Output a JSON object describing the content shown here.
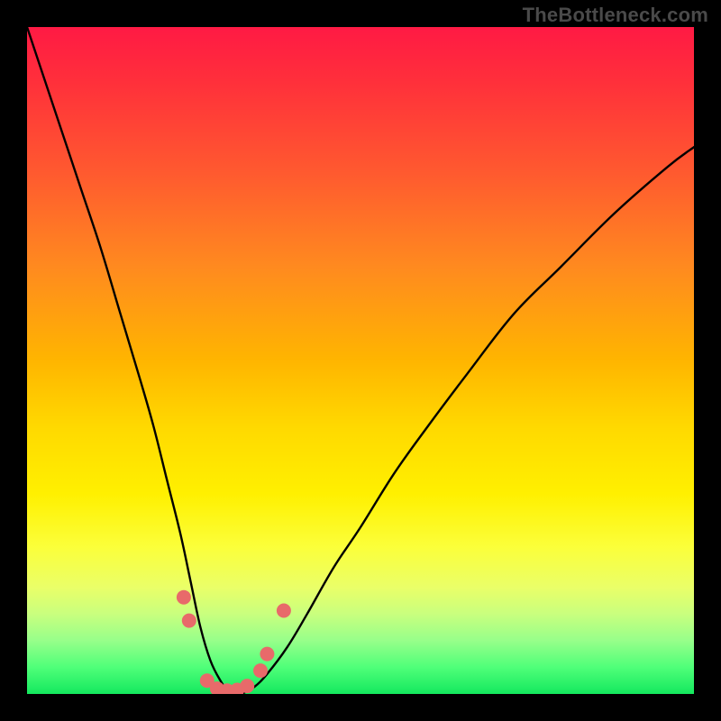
{
  "watermark": {
    "text": "TheBottleneck.com"
  },
  "chart_data": {
    "type": "line",
    "title": "",
    "xlabel": "",
    "ylabel": "",
    "xlim": [
      0,
      100
    ],
    "ylim": [
      0,
      100
    ],
    "grid": false,
    "legend": false,
    "series": [
      {
        "name": "bottleneck-curve",
        "x": [
          0,
          2,
          5,
          8,
          11,
          14,
          17,
          19,
          21,
          23,
          24.5,
          26,
          27.5,
          29,
          30.5,
          32,
          34,
          36,
          39,
          42,
          46,
          50,
          55,
          60,
          66,
          73,
          80,
          88,
          96,
          100
        ],
        "y": [
          100,
          94,
          85,
          76,
          67,
          57,
          47,
          40,
          32,
          24,
          17,
          10,
          5,
          2,
          0,
          0,
          1,
          3,
          7,
          12,
          19,
          25,
          33,
          40,
          48,
          57,
          64,
          72,
          79,
          82
        ]
      }
    ],
    "markers": [
      {
        "x": 23.5,
        "y": 14.5
      },
      {
        "x": 24.3,
        "y": 11.0
      },
      {
        "x": 27.0,
        "y": 2.0
      },
      {
        "x": 28.5,
        "y": 0.8
      },
      {
        "x": 30.0,
        "y": 0.5
      },
      {
        "x": 31.5,
        "y": 0.6
      },
      {
        "x": 33.0,
        "y": 1.2
      },
      {
        "x": 35.0,
        "y": 3.5
      },
      {
        "x": 36.0,
        "y": 6.0
      },
      {
        "x": 38.5,
        "y": 12.5
      }
    ],
    "background": {
      "type": "vertical-gradient",
      "stops": [
        {
          "pos": 0.0,
          "color": "#ff1a44"
        },
        {
          "pos": 0.5,
          "color": "#ffb500"
        },
        {
          "pos": 0.78,
          "color": "#fbff3a"
        },
        {
          "pos": 1.0,
          "color": "#14e85e"
        }
      ]
    }
  }
}
